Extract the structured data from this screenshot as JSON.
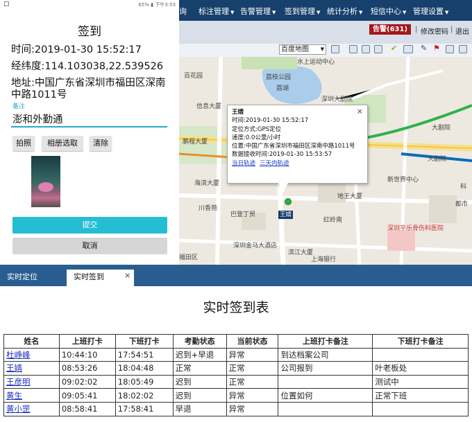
{
  "top_nav": {
    "partial_item": "询",
    "items": [
      "标注管理",
      "告警管理",
      "签到管理",
      "统计分析",
      "短信中心",
      "管理设置"
    ]
  },
  "header": {
    "alarm_badge": "告警(631)",
    "links": [
      "修改密码",
      "退出"
    ],
    "separator": "|"
  },
  "map_toolbar": {
    "map_type": "百度地图",
    "icons": [
      "layer-icon",
      "refresh-icon",
      "map-icon",
      "ruler-icon",
      "check-icon",
      "measure-icon",
      "flag-icon",
      "info-icon",
      "home-icon"
    ]
  },
  "map": {
    "labels": {
      "l1": "水上运动中心",
      "l2": "荔枝公园",
      "l3": "百花园",
      "l4": "荔湖",
      "l5": "深圳大剧院",
      "l6": "信息大厦",
      "l7": "鹏程大厦",
      "l8": "大剧院",
      "l9": "大剧院",
      "l10": "海滨大厦",
      "l11": "新世界中心",
      "l12": "地王大厦",
      "l13": "巴登丁贸",
      "l14": "红岭南",
      "l15": "川香苑",
      "l16": "深圳金马大酒店",
      "l17": "滨江大厦",
      "l18": "深圳平乐骨伤科医院",
      "l19": "福田区",
      "l20": "上海银行",
      "l21": "科",
      "l22": "都市"
    },
    "popup": {
      "name": "王婧",
      "time": "时间:2019-01-30 15:52:17",
      "method": "定位方式:GPS定位",
      "speed": "速度:0.0公里/小时",
      "position": "位置:中国广东省深圳市福田区深南中路1011号",
      "received": "数据接收时间:2019-01-30 15:53:57",
      "link_today": "当日轨迹",
      "link_3days": "三天内轨迹",
      "close": "×"
    },
    "marker_label": "王婧"
  },
  "phone": {
    "status_left": "",
    "status_right": "65% ▮ 下午3:53",
    "title": "签到",
    "time_line": "时间:2019-01-30 15:52:17",
    "coords_line": "经纬度:114.103038,22.539526",
    "address_line1": "地址:中国广东省深圳市福田区深南",
    "address_line2": "中路1011号",
    "remark_label": "备注",
    "remark_value": "澎和外勤通",
    "btn_photo": "拍照",
    "btn_album": "相册选取",
    "btn_clear": "清除",
    "btn_submit": "提交",
    "btn_cancel": "取消"
  },
  "tabs": {
    "locate": "实时定位",
    "signin": "实时签到",
    "close": "×"
  },
  "report": {
    "title": "实时签到表",
    "headers": [
      "姓名",
      "上班打卡",
      "下班打卡",
      "考勤状态",
      "当前状态",
      "上班打卡备注",
      "下班打卡备注"
    ],
    "rows": [
      [
        "杜峥峰",
        "10:44:10",
        "17:54:51",
        "迟到+早退",
        "异常",
        "到达档案公司",
        ""
      ],
      [
        "王婧",
        "08:53:26",
        "18:04:48",
        "正常",
        "正常",
        "公司报到",
        "叶老板处"
      ],
      [
        "王彦明",
        "09:02:02",
        "18:05:49",
        "迟到",
        "正常",
        "",
        "测试中"
      ],
      [
        "黄生",
        "09:05:41",
        "18:02:02",
        "迟到",
        "异常",
        "位置如何",
        "正常下班"
      ],
      [
        "黄小罡",
        "08:58:41",
        "17:58:41",
        "早退",
        "异常",
        "",
        ""
      ]
    ]
  },
  "colors": {
    "nav_bg": "#17406d",
    "alarm_red": "#a3171a",
    "accent_cyan": "#25bdd3",
    "tab_blue": "#2a5d8f",
    "link_blue": "#1a2ec0"
  }
}
